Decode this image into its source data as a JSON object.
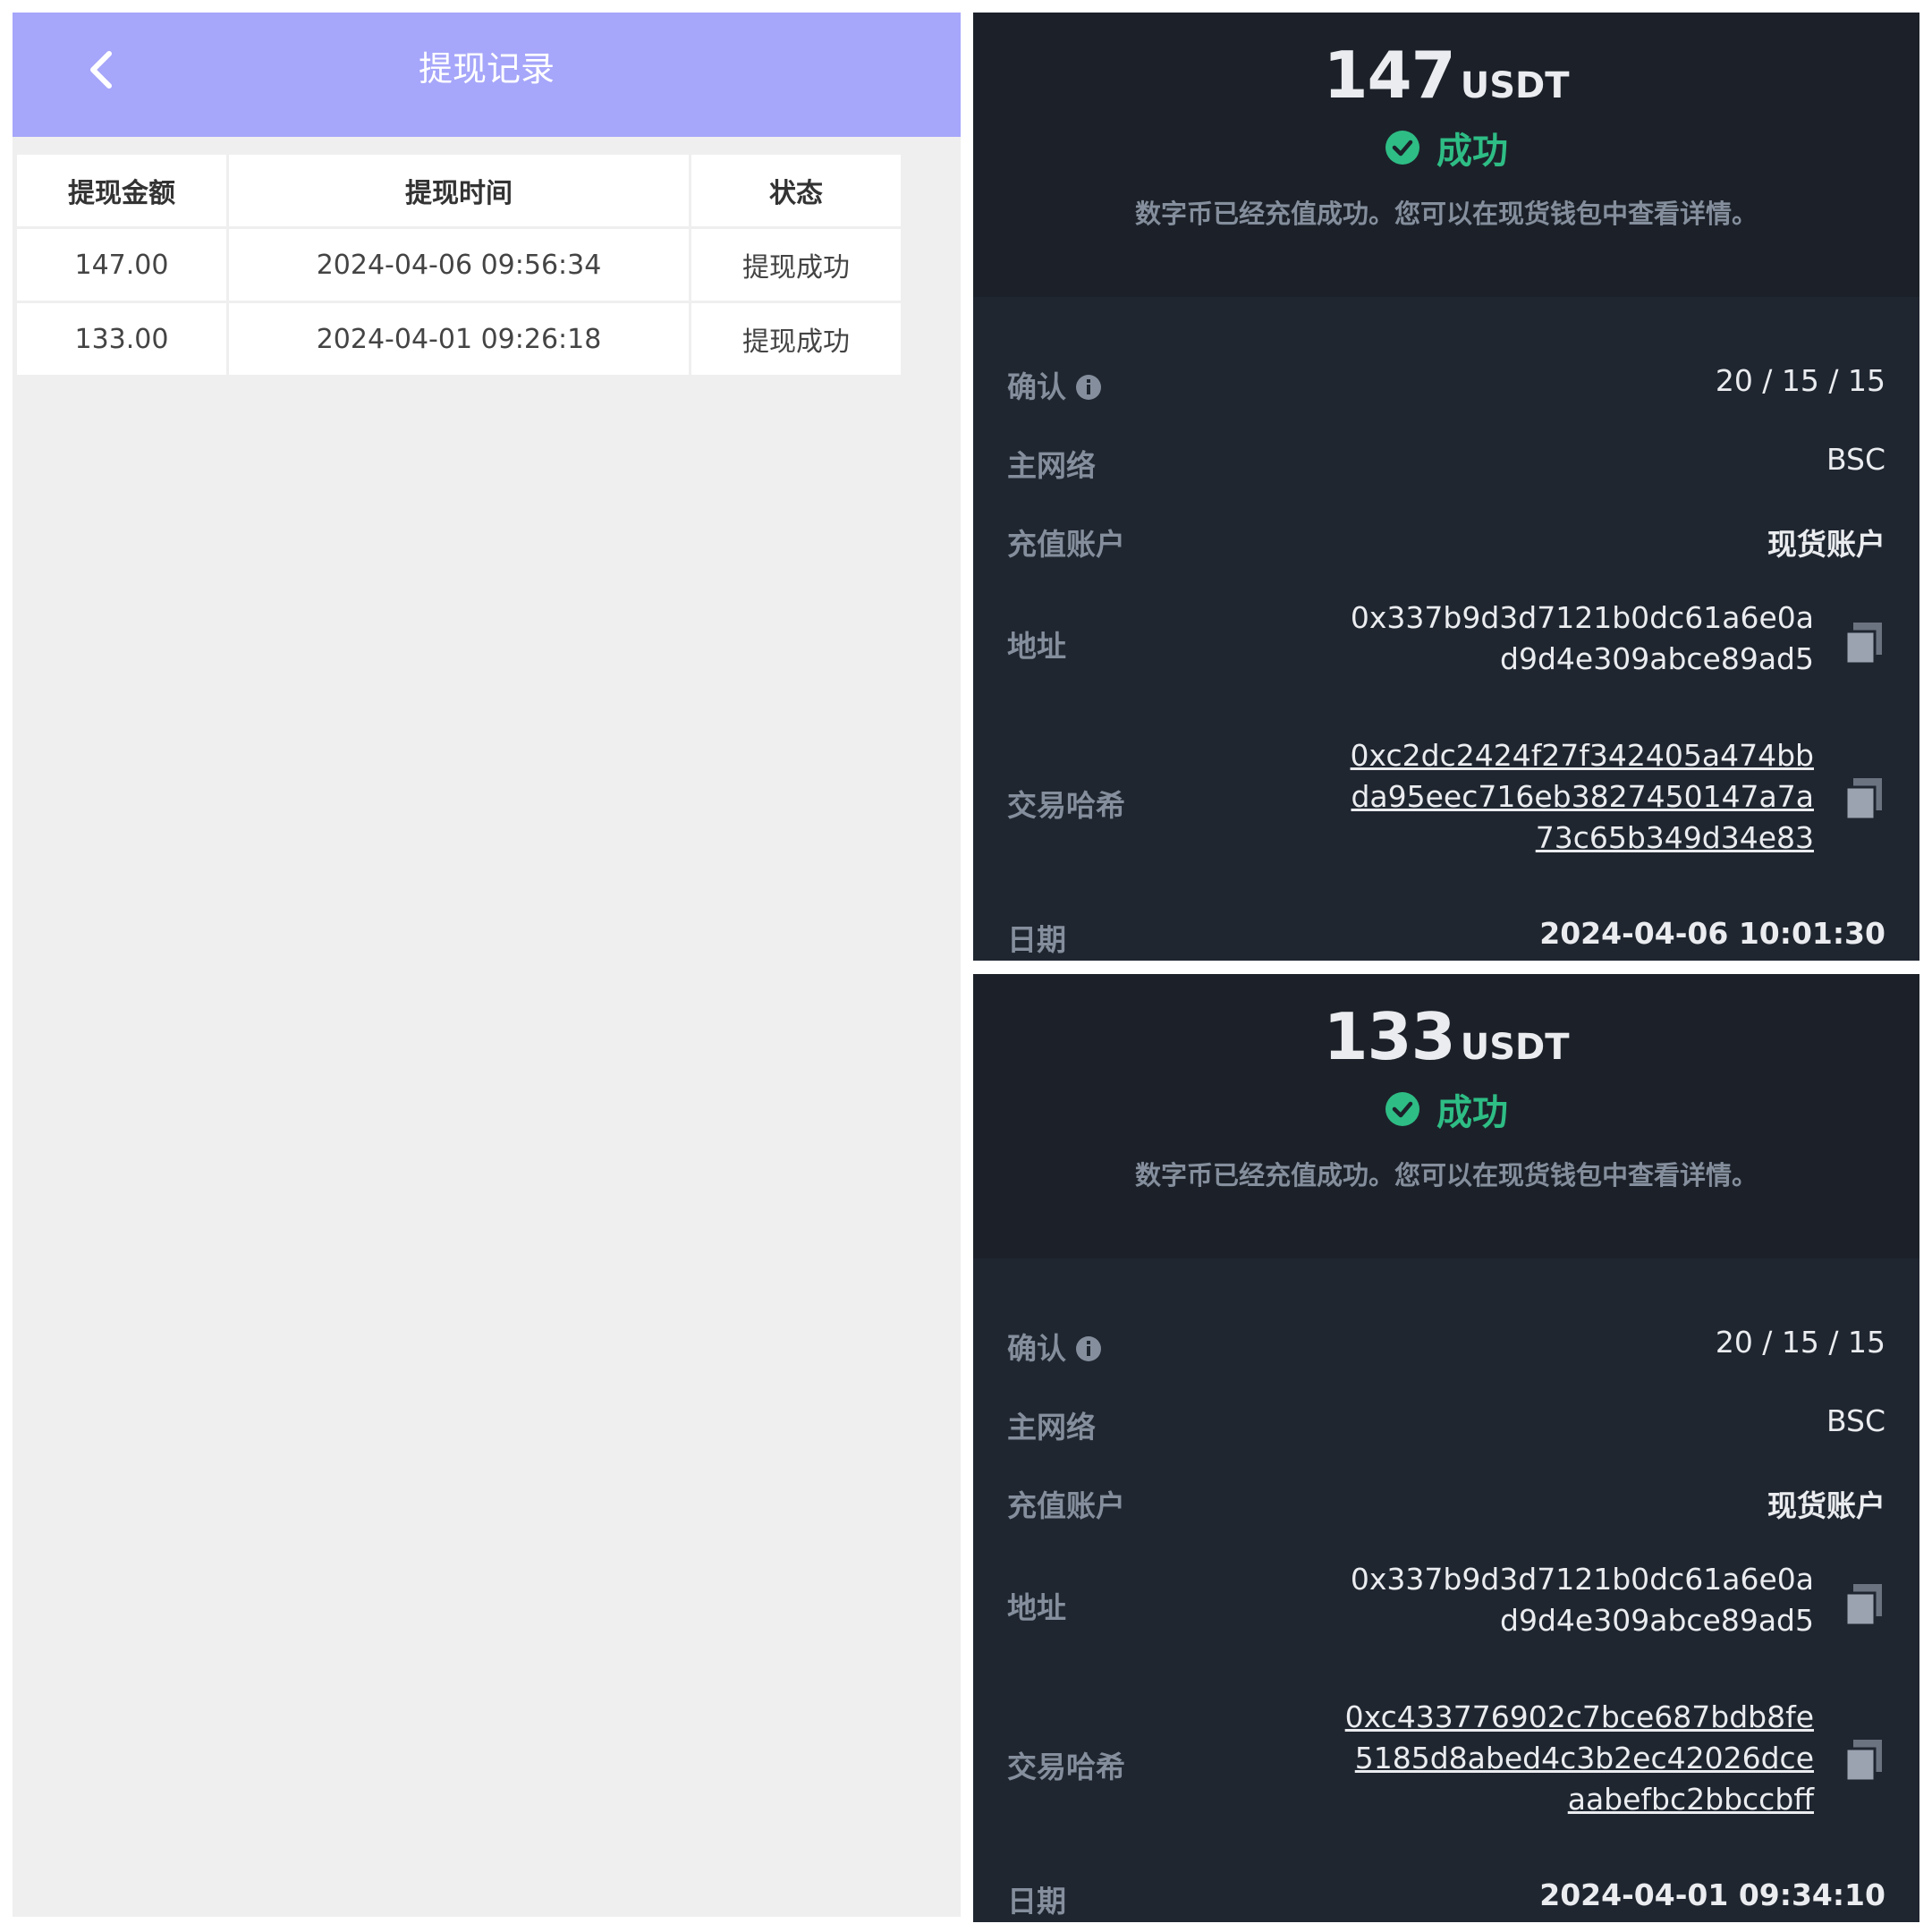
{
  "left": {
    "title": "提现记录",
    "columns": [
      "提现金额",
      "提现时间",
      "状态"
    ],
    "rows": [
      {
        "amount": "147.00",
        "time": "2024-04-06 09:56:34",
        "status": "提现成功"
      },
      {
        "amount": "133.00",
        "time": "2024-04-01 09:26:18",
        "status": "提现成功"
      }
    ]
  },
  "colors": {
    "header": "#a6a6fa",
    "card_bg": "#1f2630",
    "success": "#2ebd85",
    "muted": "#848e9c"
  },
  "cards": [
    {
      "amount": "147",
      "unit": "USDT",
      "status": "成功",
      "description": "数字币已经充值成功。您可以在现货钱包中查看详情。",
      "confirm_label": "确认",
      "confirm_value": "20 / 15 / 15",
      "network_label": "主网络",
      "network_value": "BSC",
      "account_label": "充值账户",
      "account_value": "现货账户",
      "address_label": "地址",
      "address_lines": [
        "0x337b9d3d7121b0dc61a6e0a",
        "d9d4e309abce89ad5"
      ],
      "hash_label": "交易哈希",
      "hash_lines": [
        "0xc2dc2424f27f342405a474bb",
        "da95eec716eb3827450147a7a",
        "73c65b349d34e83"
      ],
      "date_label": "日期",
      "date_value": "2024-04-06 10:01:30"
    },
    {
      "amount": "133",
      "unit": "USDT",
      "status": "成功",
      "description": "数字币已经充值成功。您可以在现货钱包中查看详情。",
      "confirm_label": "确认",
      "confirm_value": "20 / 15 / 15",
      "network_label": "主网络",
      "network_value": "BSC",
      "account_label": "充值账户",
      "account_value": "现货账户",
      "address_label": "地址",
      "address_lines": [
        "0x337b9d3d7121b0dc61a6e0a",
        "d9d4e309abce89ad5"
      ],
      "hash_label": "交易哈希",
      "hash_lines": [
        "0xc433776902c7bce687bdb8fe",
        "5185d8abed4c3b2ec42026dce",
        "aabefbc2bbccbff"
      ],
      "date_label": "日期",
      "date_value": "2024-04-01 09:34:10"
    }
  ]
}
